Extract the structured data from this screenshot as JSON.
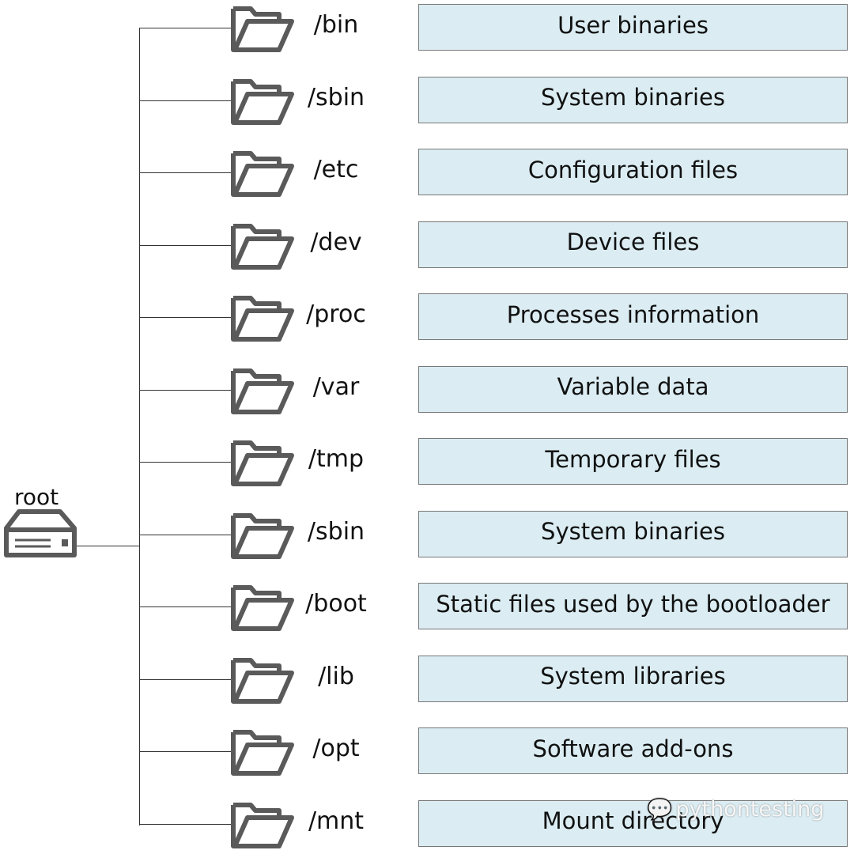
{
  "root": {
    "label": "root",
    "icon": "hard-drive-icon"
  },
  "directories": [
    {
      "name": "/bin",
      "description": "User binaries"
    },
    {
      "name": "/sbin",
      "description": "System binaries"
    },
    {
      "name": "/etc",
      "description": "Configuration files"
    },
    {
      "name": "/dev",
      "description": "Device files"
    },
    {
      "name": "/proc",
      "description": "Processes information"
    },
    {
      "name": "/var",
      "description": "Variable data"
    },
    {
      "name": "/tmp",
      "description": "Temporary files"
    },
    {
      "name": "/sbin",
      "description": "System binaries"
    },
    {
      "name": "/boot",
      "description": "Static files used by the bootloader"
    },
    {
      "name": "/lib",
      "description": "System libraries"
    },
    {
      "name": "/opt",
      "description": "Software add-ons"
    },
    {
      "name": "/mnt",
      "description": "Mount directory"
    }
  ],
  "watermark": "pythontesting",
  "colors": {
    "box_fill": "#dbedf3",
    "icon_gray": "#5a5a5a",
    "line": "#333333"
  }
}
